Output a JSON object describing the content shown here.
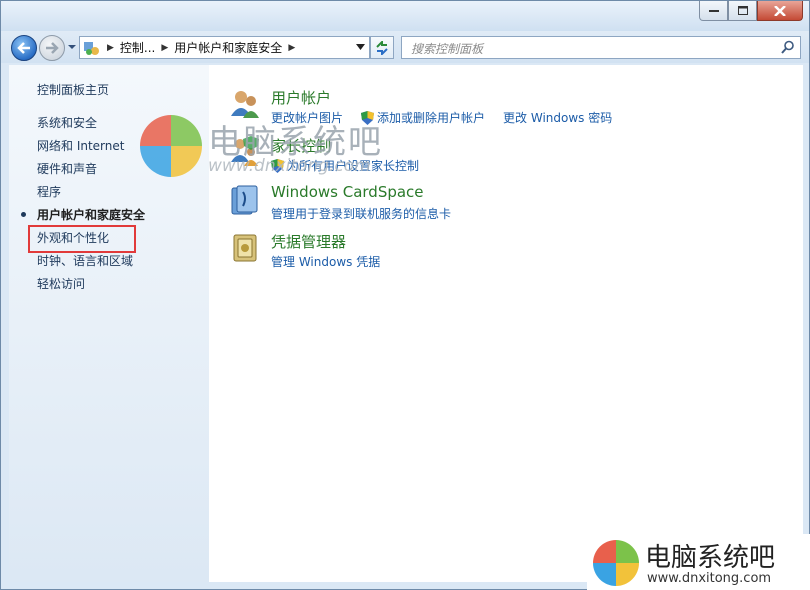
{
  "window": {
    "controls": {
      "minimize": "minimize",
      "maximize": "maximize",
      "close": "close"
    }
  },
  "navbar": {
    "breadcrumb": [
      "控制...",
      "用户帐户和家庭安全"
    ],
    "search_placeholder": "搜索控制面板"
  },
  "sidebar": {
    "home": "控制面板主页",
    "items": [
      {
        "label": "系统和安全",
        "active": false
      },
      {
        "label": "网络和 Internet",
        "active": false
      },
      {
        "label": "硬件和声音",
        "active": false
      },
      {
        "label": "程序",
        "active": false
      },
      {
        "label": "用户帐户和家庭安全",
        "active": true
      },
      {
        "label": "外观和个性化",
        "active": false,
        "highlighted": true
      },
      {
        "label": "时钟、语言和区域",
        "active": false
      },
      {
        "label": "轻松访问",
        "active": false
      }
    ]
  },
  "main": {
    "categories": [
      {
        "title": "用户帐户",
        "icon": "users-icon",
        "links": [
          "更改帐户图片",
          "添加或删除用户帐户",
          "更改 Windows 密码"
        ]
      },
      {
        "title": "家长控制",
        "icon": "parental-control-icon",
        "links": [
          "为所有用户设置家长控制"
        ]
      },
      {
        "title": "Windows CardSpace",
        "icon": "cardspace-icon",
        "links": [
          "管理用于登录到联机服务的信息卡"
        ]
      },
      {
        "title": "凭据管理器",
        "icon": "credential-manager-icon",
        "links": [
          "管理 Windows 凭据"
        ]
      }
    ]
  },
  "watermark": {
    "text": "电脑系统吧",
    "url": "www.dnxitong.com"
  },
  "badge": {
    "text": "电脑系统吧",
    "url": "www.dnxitong.com"
  },
  "colors": {
    "link": "#1c5ca8",
    "category_title": "#2a7a2a",
    "sidebar_text": "#1e395b",
    "highlight_box": "#e13a3a"
  }
}
